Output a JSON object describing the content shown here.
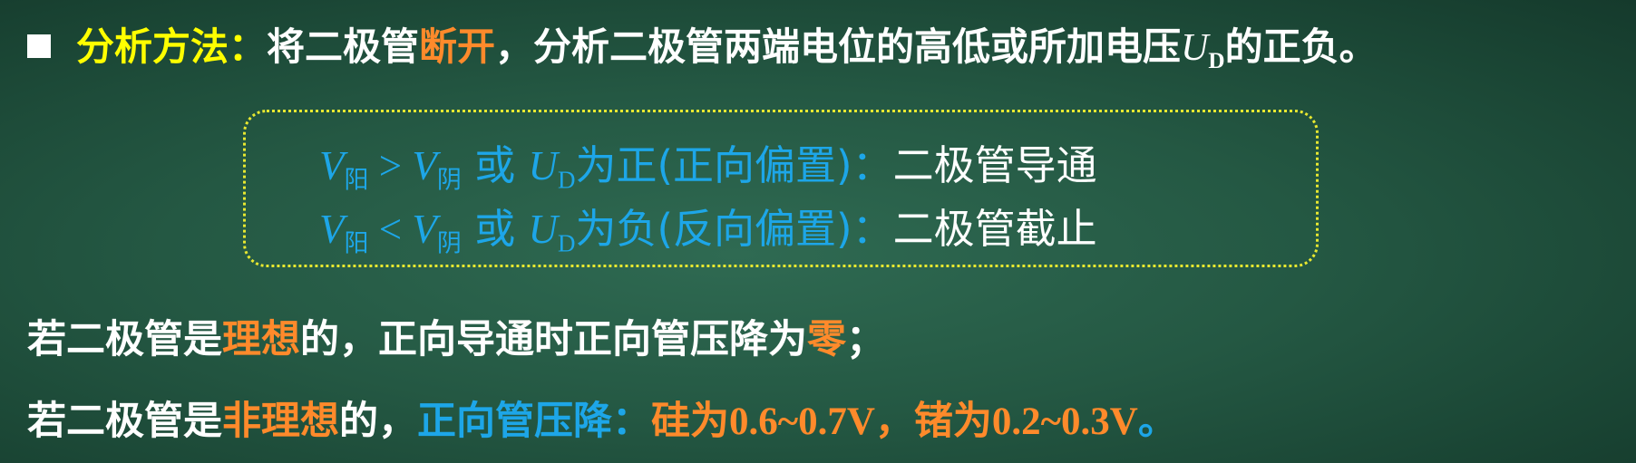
{
  "line1": {
    "label": "分析方法：",
    "t1": "将二极管",
    "hl": "断开",
    "t2": "，分析二极管两端电位的高低或所加电压",
    "var": "U",
    "sub": "D",
    "t3": "的正负。"
  },
  "cond1": {
    "v1": "V",
    "s1": "阳",
    "op": " > ",
    "v2": "V",
    "s2": "阴",
    "or": " 或 ",
    "u": "U",
    "su": "D",
    "desc": "为正(正向偏置)：",
    "result": "二极管导通"
  },
  "cond2": {
    "v1": "V",
    "s1": "阳",
    "op": " < ",
    "v2": "V",
    "s2": "阴",
    "or": " 或 ",
    "u": "U",
    "su": "D",
    "desc": "为负(反向偏置)：",
    "result": "二极管截止"
  },
  "line4": {
    "t1": "若二极管是",
    "hl1": "理想",
    "t2": "的，正向导通时正向管压降为",
    "hl2": "零",
    "t3": "；"
  },
  "line5": {
    "t1": "若二极管是",
    "hl1": "非理想",
    "t2": "的，",
    "label": "正向管压降：",
    "si": "硅为",
    "si_val": "0.6~0.7V",
    "sep": "，",
    "ge": "锗为",
    "ge_val": "0.2~0.3V",
    "end": "。"
  },
  "colors": {
    "background": "#245843",
    "yellow": "#ffff00",
    "orange": "#ff8a2b",
    "blue": "#1da6e8",
    "box_border": "#e8e830"
  }
}
